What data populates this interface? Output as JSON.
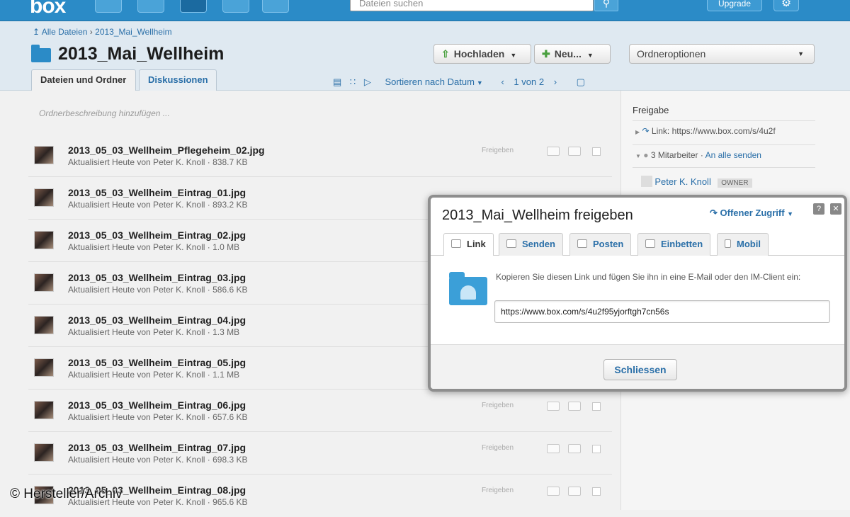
{
  "topbar": {
    "logo": "box",
    "search_placeholder": "Dateien suchen",
    "upgrade_label": "Upgrade"
  },
  "header": {
    "breadcrumb_root": "Alle Dateien",
    "breadcrumb_sep": "›",
    "breadcrumb_current": "2013_Mai_Wellheim",
    "title": "2013_Mai_Wellheim",
    "upload_label": "Hochladen",
    "new_label": "Neu...",
    "folder_options_label": "Ordneroptionen",
    "tabs": [
      "Dateien und Ordner",
      "Diskussionen"
    ],
    "sort_label": "Sortieren nach Datum",
    "page_label": "1 von 2"
  },
  "list": {
    "description_placeholder": "Ordnerbeschreibung hinzufügen ...",
    "share_label": "Freigeben",
    "files": [
      {
        "name": "2013_05_03_Wellheim_Pflegeheim_02.jpg",
        "meta": "Aktualisiert Heute von Peter K. Knoll  ·  838.7 KB"
      },
      {
        "name": "2013_05_03_Wellheim_Eintrag_01.jpg",
        "meta": "Aktualisiert Heute von Peter K. Knoll  ·  893.2 KB"
      },
      {
        "name": "2013_05_03_Wellheim_Eintrag_02.jpg",
        "meta": "Aktualisiert Heute von Peter K. Knoll  ·  1.0 MB"
      },
      {
        "name": "2013_05_03_Wellheim_Eintrag_03.jpg",
        "meta": "Aktualisiert Heute von Peter K. Knoll  ·  586.6 KB"
      },
      {
        "name": "2013_05_03_Wellheim_Eintrag_04.jpg",
        "meta": "Aktualisiert Heute von Peter K. Knoll  ·  1.3 MB"
      },
      {
        "name": "2013_05_03_Wellheim_Eintrag_05.jpg",
        "meta": "Aktualisiert Heute von Peter K. Knoll  ·  1.1 MB"
      },
      {
        "name": "2013_05_03_Wellheim_Eintrag_06.jpg",
        "meta": "Aktualisiert Heute von Peter K. Knoll  ·  657.6 KB"
      },
      {
        "name": "2013_05_03_Wellheim_Eintrag_07.jpg",
        "meta": "Aktualisiert Heute von Peter K. Knoll  ·  698.3 KB"
      },
      {
        "name": "2013_05_03_Wellheim_Eintrag_08.jpg",
        "meta": "Aktualisiert Heute von Peter K. Knoll  ·  965.6 KB"
      }
    ]
  },
  "sidebar": {
    "heading": "Freigabe",
    "link_prefix": "Link:",
    "link_value": "https://www.box.com/s/4u2f",
    "collaborators": "3 Mitarbeiter",
    "send_all": "An alle senden",
    "owner_name": "Peter K. Knoll",
    "owner_badge": "OWNER"
  },
  "dialog": {
    "title": "2013_Mai_Wellheim freigeben",
    "access_label": "Offener Zugriff",
    "tabs": [
      "Link",
      "Senden",
      "Posten",
      "Einbetten",
      "Mobil"
    ],
    "instruction": "Kopieren Sie diesen Link und fügen Sie ihn in eine E-Mail oder den IM-Client ein:",
    "link_value": "https://www.box.com/s/4u2f95yjorftgh7cn56s",
    "close_label": "Schliessen"
  },
  "watermark": "© Hersteller/Archiv",
  "colors": {
    "topbar": "#2b8bc7",
    "link": "#2a6fa8",
    "upload_arrow": "#4aa040"
  }
}
